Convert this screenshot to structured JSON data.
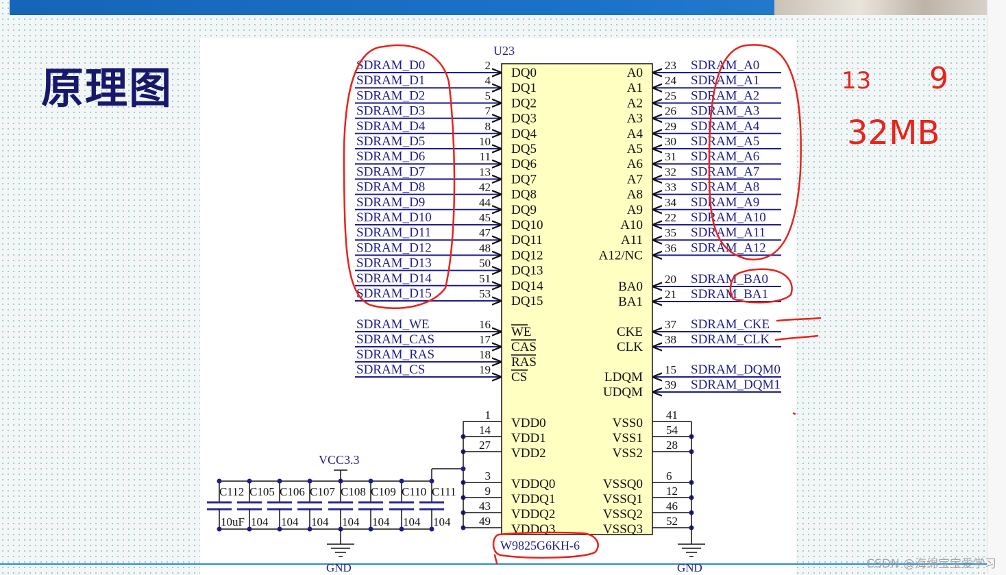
{
  "slide": {
    "title": "原理图",
    "watermark": "CSDN @海绵宝宝爱学习"
  },
  "schematic": {
    "designator": "U23",
    "part_number": "W9825G6KH-6",
    "left_pins": [
      {
        "net": "SDRAM_D0",
        "pin": "2",
        "name": "DQ0"
      },
      {
        "net": "SDRAM_D1",
        "pin": "4",
        "name": "DQ1"
      },
      {
        "net": "SDRAM_D2",
        "pin": "5",
        "name": "DQ2"
      },
      {
        "net": "SDRAM_D3",
        "pin": "7",
        "name": "DQ3"
      },
      {
        "net": "SDRAM_D4",
        "pin": "8",
        "name": "DQ4"
      },
      {
        "net": "SDRAM_D5",
        "pin": "10",
        "name": "DQ5"
      },
      {
        "net": "SDRAM_D6",
        "pin": "11",
        "name": "DQ6"
      },
      {
        "net": "SDRAM_D7",
        "pin": "13",
        "name": "DQ7"
      },
      {
        "net": "SDRAM_D8",
        "pin": "42",
        "name": "DQ8"
      },
      {
        "net": "SDRAM_D9",
        "pin": "44",
        "name": "DQ9"
      },
      {
        "net": "SDRAM_D10",
        "pin": "45",
        "name": "DQ10"
      },
      {
        "net": "SDRAM_D11",
        "pin": "47",
        "name": "DQ11"
      },
      {
        "net": "SDRAM_D12",
        "pin": "48",
        "name": "DQ12"
      },
      {
        "net": "SDRAM_D13",
        "pin": "50",
        "name": "DQ13"
      },
      {
        "net": "SDRAM_D14",
        "pin": "51",
        "name": "DQ14"
      },
      {
        "net": "SDRAM_D15",
        "pin": "53",
        "name": "DQ15"
      },
      {
        "net": "SDRAM_WE",
        "pin": "16",
        "name": "WE"
      },
      {
        "net": "SDRAM_CAS",
        "pin": "17",
        "name": "CAS"
      },
      {
        "net": "SDRAM_RAS",
        "pin": "18",
        "name": "RAS"
      },
      {
        "net": "SDRAM_CS",
        "pin": "19",
        "name": "CS"
      }
    ],
    "right_pins": [
      {
        "net": "SDRAM_A0",
        "pin": "23",
        "name": "A0"
      },
      {
        "net": "SDRAM_A1",
        "pin": "24",
        "name": "A1"
      },
      {
        "net": "SDRAM_A2",
        "pin": "25",
        "name": "A2"
      },
      {
        "net": "SDRAM_A3",
        "pin": "26",
        "name": "A3"
      },
      {
        "net": "SDRAM_A4",
        "pin": "29",
        "name": "A4"
      },
      {
        "net": "SDRAM_A5",
        "pin": "30",
        "name": "A5"
      },
      {
        "net": "SDRAM_A6",
        "pin": "31",
        "name": "A6"
      },
      {
        "net": "SDRAM_A7",
        "pin": "32",
        "name": "A7"
      },
      {
        "net": "SDRAM_A8",
        "pin": "33",
        "name": "A8"
      },
      {
        "net": "SDRAM_A9",
        "pin": "34",
        "name": "A9"
      },
      {
        "net": "SDRAM_A10",
        "pin": "22",
        "name": "A10"
      },
      {
        "net": "SDRAM_A11",
        "pin": "35",
        "name": "A11"
      },
      {
        "net": "SDRAM_A12",
        "pin": "36",
        "name": "A12/NC"
      },
      {
        "net": "SDRAM_BA0",
        "pin": "20",
        "name": "BA0"
      },
      {
        "net": "SDRAM_BA1",
        "pin": "21",
        "name": "BA1"
      },
      {
        "net": "SDRAM_CKE",
        "pin": "37",
        "name": "CKE"
      },
      {
        "net": "SDRAM_CLK",
        "pin": "38",
        "name": "CLK"
      },
      {
        "net": "SDRAM_DQM0",
        "pin": "15",
        "name": "LDQM"
      },
      {
        "net": "SDRAM_DQM1",
        "pin": "39",
        "name": "UDQM"
      }
    ],
    "power_left": [
      {
        "pin": "1",
        "name": "VDD0"
      },
      {
        "pin": "14",
        "name": "VDD1"
      },
      {
        "pin": "27",
        "name": "VDD2"
      },
      {
        "pin": "3",
        "name": "VDDQ0"
      },
      {
        "pin": "9",
        "name": "VDDQ1"
      },
      {
        "pin": "43",
        "name": "VDDQ2"
      },
      {
        "pin": "49",
        "name": "VDDQ3"
      }
    ],
    "power_right": [
      {
        "pin": "41",
        "name": "VSS0"
      },
      {
        "pin": "54",
        "name": "VSS1"
      },
      {
        "pin": "28",
        "name": "VSS2"
      },
      {
        "pin": "6",
        "name": "VSSQ0"
      },
      {
        "pin": "12",
        "name": "VSSQ1"
      },
      {
        "pin": "46",
        "name": "VSSQ2"
      },
      {
        "pin": "52",
        "name": "VSSQ3"
      }
    ],
    "vcc_label": "VCC3.3",
    "gnd_label": "GND",
    "capacitors": [
      {
        "ref": "C112",
        "value": "10uF"
      },
      {
        "ref": "C105",
        "value": "104"
      },
      {
        "ref": "C106",
        "value": "104"
      },
      {
        "ref": "C107",
        "value": "104"
      },
      {
        "ref": "C108",
        "value": "104"
      },
      {
        "ref": "C109",
        "value": "104"
      },
      {
        "ref": "C110",
        "value": "104"
      },
      {
        "ref": "C111",
        "value": "104"
      }
    ]
  },
  "handwritten": {
    "row_bits": "13",
    "col_bits": "9",
    "capacity": "32MB"
  },
  "colors": {
    "net": "#1d1d8c",
    "chip_fill": "#ffffc2",
    "annotation": "#e8231b"
  }
}
